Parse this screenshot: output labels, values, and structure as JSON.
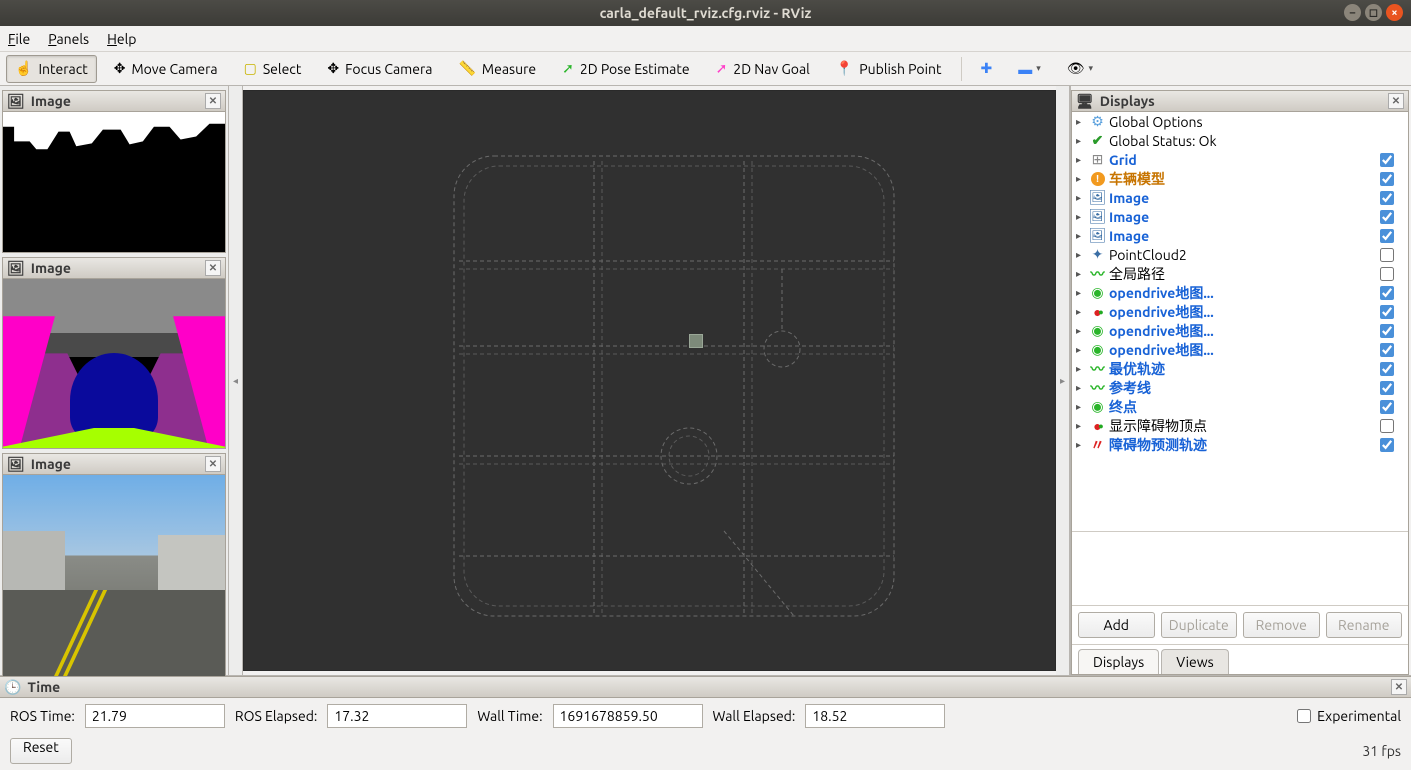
{
  "window": {
    "title": "carla_default_rviz.cfg.rviz - RViz"
  },
  "menu": {
    "file": "File",
    "panels": "Panels",
    "help": "Help"
  },
  "toolbar": {
    "interact": "Interact",
    "move_camera": "Move Camera",
    "select": "Select",
    "focus_camera": "Focus Camera",
    "measure": "Measure",
    "pose_estimate": "2D Pose Estimate",
    "nav_goal": "2D Nav Goal",
    "publish_point": "Publish Point"
  },
  "left_panels": {
    "p1": "Image",
    "p2": "Image",
    "p3": "Image"
  },
  "displays": {
    "title": "Displays",
    "items": [
      {
        "label": "Global Options",
        "style": "plain",
        "icon": "gear",
        "check": null
      },
      {
        "label": "Global Status: Ok",
        "style": "plain",
        "icon": "check",
        "check": null
      },
      {
        "label": "Grid",
        "style": "link",
        "icon": "grid",
        "check": true
      },
      {
        "label": "车辆模型",
        "style": "orange",
        "icon": "warn",
        "check": true
      },
      {
        "label": "Image",
        "style": "link",
        "icon": "img",
        "check": true
      },
      {
        "label": "Image",
        "style": "link",
        "icon": "img",
        "check": true
      },
      {
        "label": "Image",
        "style": "link",
        "icon": "img",
        "check": true
      },
      {
        "label": "PointCloud2",
        "style": "plain",
        "icon": "pcl",
        "check": false
      },
      {
        "label": "全局路径",
        "style": "plain",
        "icon": "path",
        "check": false
      },
      {
        "label": "opendrive地图...",
        "style": "link",
        "icon": "cube",
        "check": true
      },
      {
        "label": "opendrive地图...",
        "style": "link",
        "icon": "cubes",
        "check": true
      },
      {
        "label": "opendrive地图...",
        "style": "link",
        "icon": "cube",
        "check": true
      },
      {
        "label": "opendrive地图...",
        "style": "link",
        "icon": "cube",
        "check": true
      },
      {
        "label": "最优轨迹",
        "style": "link",
        "icon": "path",
        "check": true
      },
      {
        "label": "参考线",
        "style": "link",
        "icon": "path",
        "check": true
      },
      {
        "label": "终点",
        "style": "link",
        "icon": "cube",
        "check": true
      },
      {
        "label": "显示障碍物顶点",
        "style": "plain",
        "icon": "cubes",
        "check": false
      },
      {
        "label": "障碍物预测轨迹",
        "style": "link",
        "icon": "zz",
        "check": true
      }
    ],
    "buttons": {
      "add": "Add",
      "duplicate": "Duplicate",
      "remove": "Remove",
      "rename": "Rename"
    },
    "tabs": {
      "displays": "Displays",
      "views": "Views"
    }
  },
  "time": {
    "title": "Time",
    "ros_time_label": "ROS Time:",
    "ros_time": "21.79",
    "ros_elapsed_label": "ROS Elapsed:",
    "ros_elapsed": "17.32",
    "wall_time_label": "Wall Time:",
    "wall_time": "1691678859.50",
    "wall_elapsed_label": "Wall Elapsed:",
    "wall_elapsed": "18.52",
    "experimental": "Experimental",
    "reset": "Reset",
    "fps": "31 fps"
  }
}
